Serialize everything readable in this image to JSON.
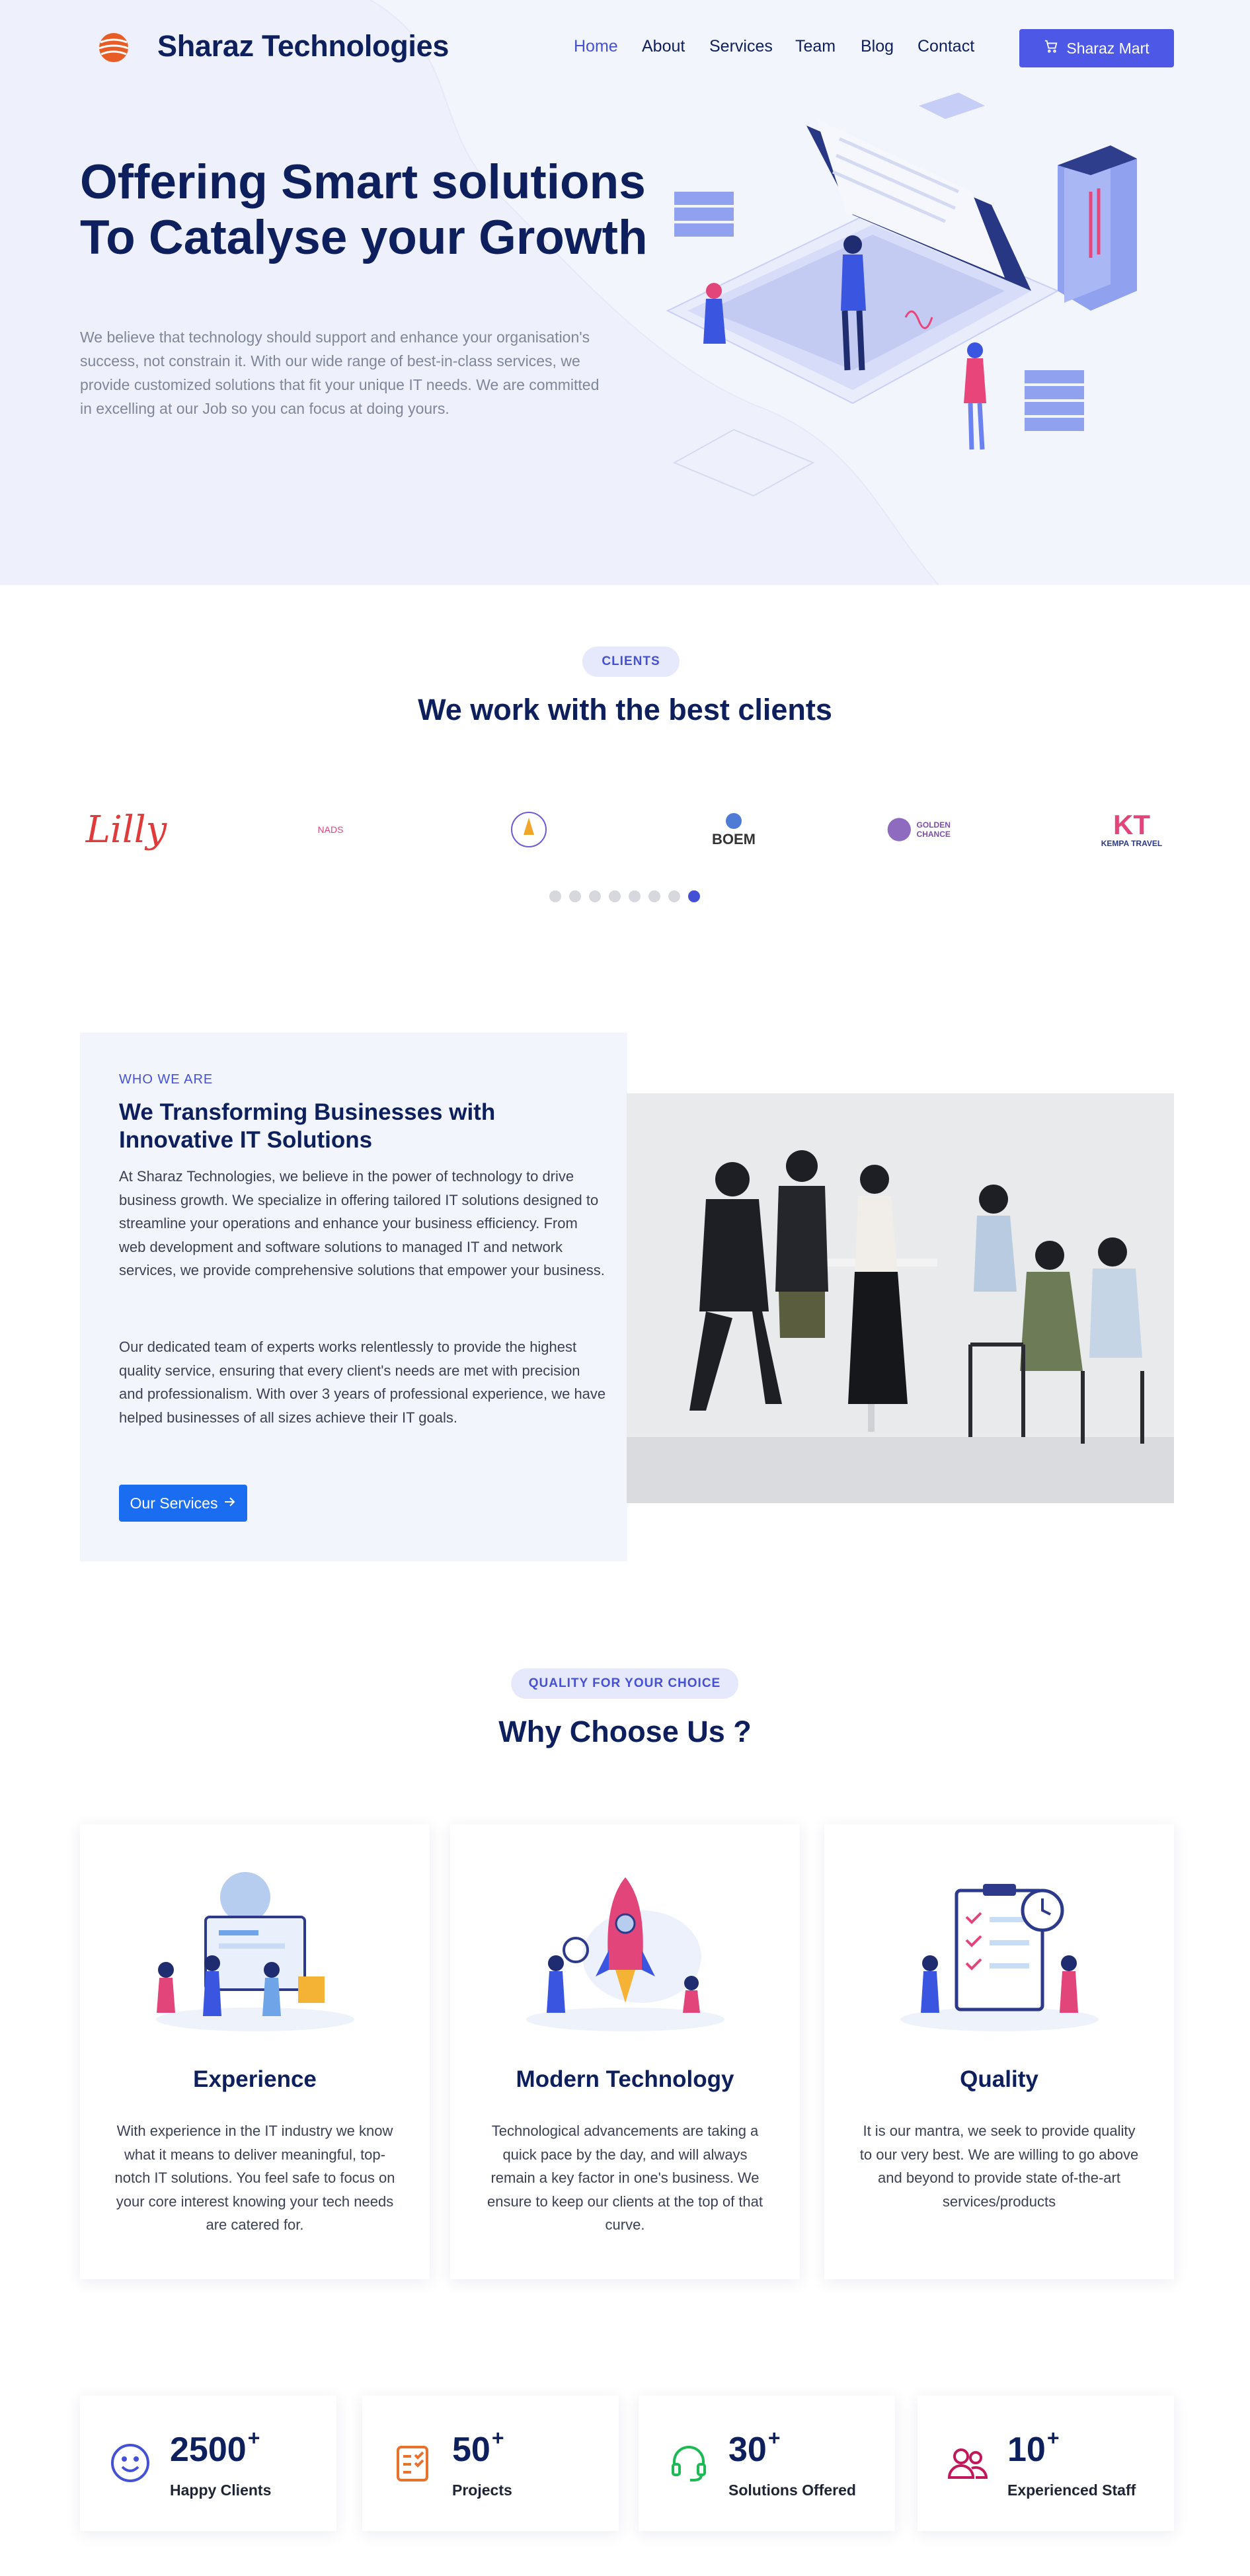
{
  "brand": {
    "name": "Sharaz Technologies",
    "logo": "globe-logo-icon"
  },
  "nav": {
    "items": [
      {
        "label": "Home",
        "active": true
      },
      {
        "label": "About"
      },
      {
        "label": "Services"
      },
      {
        "label": "Team"
      },
      {
        "label": "Blog"
      },
      {
        "label": "Contact"
      }
    ],
    "cta": {
      "label": "Sharaz Mart",
      "icon": "cart-icon"
    }
  },
  "hero": {
    "title": "Offering Smart solutions To Catalyse your Growth",
    "description": "We believe that technology should support and enhance your organisation's success, not constrain it. With our wide range of best-in-class services, we provide customized solutions that fit your unique IT needs. We are committed in excelling at our Job so you can focus at doing yours."
  },
  "clients": {
    "badge": "CLIENTS",
    "title": "We work with the best clients",
    "logos": [
      {
        "text": "Lilly"
      },
      {
        "text": "NADS"
      },
      {
        "text": ""
      },
      {
        "text": "BOEM"
      },
      {
        "text": "GOLDEN CHANCE"
      },
      {
        "text": "KEMPA TRAVEL"
      }
    ],
    "carousel_pages": 8,
    "carousel_active": 8
  },
  "who": {
    "eyebrow": "WHO WE ARE",
    "title": "We Transforming Businesses with Innovative IT Solutions",
    "p1": "At Sharaz Technologies, we believe in the power of technology to drive business growth. We specialize in offering tailored IT solutions designed to streamline your operations and enhance your business efficiency. From web development and software solutions to managed IT and network services, we provide comprehensive solutions that empower your business.",
    "p2": "Our dedicated team of experts works relentlessly to provide the highest quality service, ensuring that every client's needs are met with precision and professionalism. With over 3 years of professional experience, we have helped businesses of all sizes achieve their IT goals.",
    "button": "Our Services"
  },
  "why": {
    "badge": "QUALITY FOR YOUR CHOICE",
    "title": "Why Choose Us ?",
    "cards": [
      {
        "title": "Experience",
        "text": "With experience in the IT industry we know what it means to deliver meaningful, top-notch IT solutions. You feel safe to focus on your core interest knowing your tech needs are catered for."
      },
      {
        "title": "Modern Technology",
        "text": "Technological advancements are taking a quick pace by the day, and will always remain a key factor in one's business. We ensure to keep our clients at the top of that curve."
      },
      {
        "title": "Quality",
        "text": "It is our mantra, we seek to provide quality to our very best. We are willing to go above and beyond to provide state of-the-art services/products"
      }
    ]
  },
  "stats": [
    {
      "number": "2500",
      "suffix": "+",
      "label": "Happy Clients",
      "icon": "smile-icon",
      "color": "#4451d6"
    },
    {
      "number": "50",
      "suffix": "+",
      "label": "Projects",
      "icon": "checklist-icon",
      "color": "#e8712b"
    },
    {
      "number": "30",
      "suffix": "+",
      "label": "Solutions Offered",
      "icon": "headset-icon",
      "color": "#1db954"
    },
    {
      "number": "10",
      "suffix": "+",
      "label": "Experienced Staff",
      "icon": "users-icon",
      "color": "#c2185b"
    }
  ]
}
